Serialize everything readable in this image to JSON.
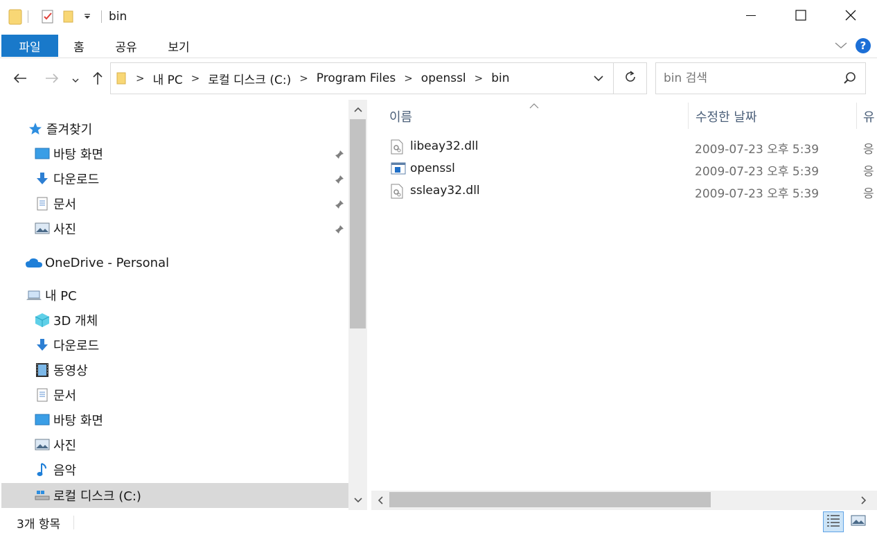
{
  "window": {
    "title": "bin",
    "minimize_icon": "minimize-icon",
    "maximize_icon": "maximize-icon",
    "close_icon": "close-icon"
  },
  "ribbon": {
    "tabs": [
      {
        "label": "파일"
      },
      {
        "label": "홈"
      },
      {
        "label": "공유"
      },
      {
        "label": "보기"
      }
    ]
  },
  "address": {
    "crumbs": [
      "내 PC",
      "로컬 디스크 (C:)",
      "Program Files",
      "openssl",
      "bin"
    ]
  },
  "search": {
    "placeholder": "bin 검색"
  },
  "nav": {
    "quick_access": "즐겨찾기",
    "quick_items": [
      {
        "label": "바탕 화면",
        "icon": "desktop-icon"
      },
      {
        "label": "다운로드",
        "icon": "download-icon"
      },
      {
        "label": "문서",
        "icon": "document-icon"
      },
      {
        "label": "사진",
        "icon": "picture-icon"
      }
    ],
    "onedrive": "OneDrive - Personal",
    "this_pc": "내 PC",
    "pc_items": [
      {
        "label": "3D 개체",
        "icon": "3d-objects-icon"
      },
      {
        "label": "다운로드",
        "icon": "download-icon"
      },
      {
        "label": "동영상",
        "icon": "video-icon"
      },
      {
        "label": "문서",
        "icon": "document-icon"
      },
      {
        "label": "바탕 화면",
        "icon": "desktop-icon"
      },
      {
        "label": "사진",
        "icon": "picture-icon"
      },
      {
        "label": "음악",
        "icon": "music-icon"
      },
      {
        "label": "로컬 디스크 (C:)",
        "icon": "drive-icon"
      }
    ]
  },
  "columns": {
    "name": "이름",
    "date": "수정한 날짜",
    "type": "유"
  },
  "files": [
    {
      "name": "libeay32.dll",
      "date": "2009-07-23 오후 5:39",
      "type": "응",
      "icon": "dll-file-icon"
    },
    {
      "name": "openssl",
      "date": "2009-07-23 오후 5:39",
      "type": "응",
      "icon": "exe-file-icon"
    },
    {
      "name": "ssleay32.dll",
      "date": "2009-07-23 오후 5:39",
      "type": "응",
      "icon": "dll-file-icon"
    }
  ],
  "status": {
    "item_count": "3개 항목"
  },
  "colors": {
    "accent": "#1979ca",
    "selected_bg": "#d9d9d9",
    "header_text": "#4c607a"
  }
}
